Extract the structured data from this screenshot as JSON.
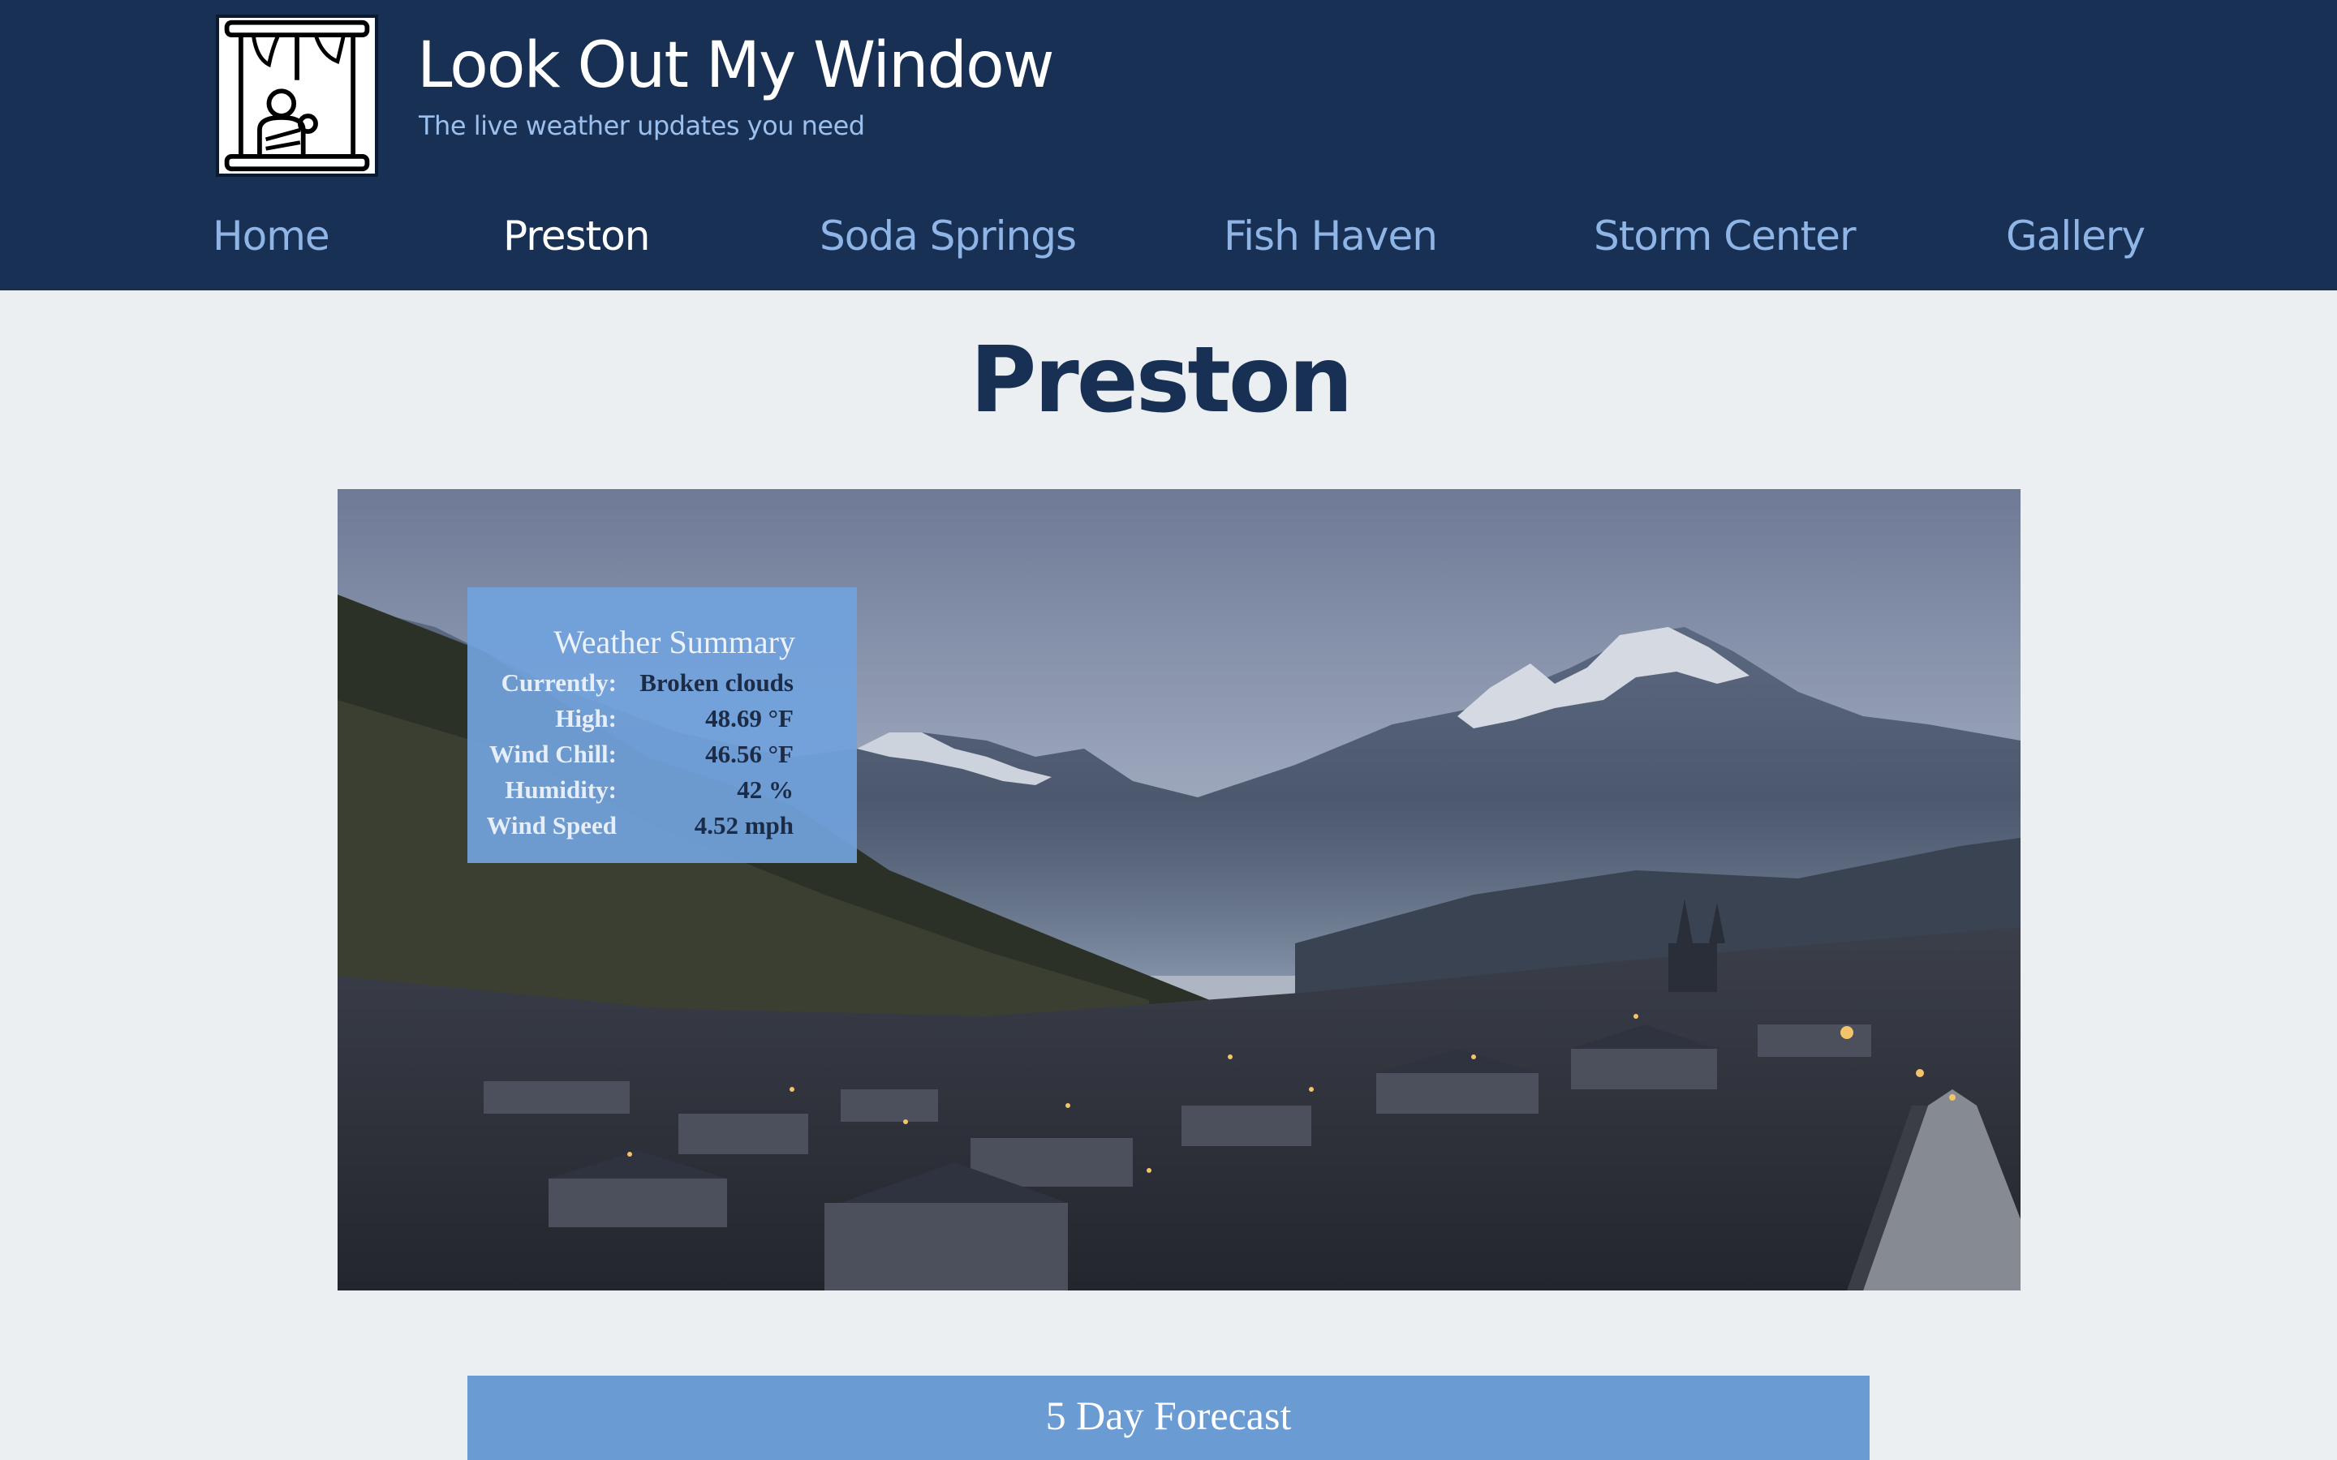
{
  "header": {
    "logo_icon": "window-person-icon",
    "title": "Look Out My Window",
    "tagline": "The live weather updates you need"
  },
  "nav": {
    "items": [
      {
        "label": "Home"
      },
      {
        "label": "Preston"
      },
      {
        "label": "Soda Springs"
      },
      {
        "label": "Fish Haven"
      },
      {
        "label": "Storm Center"
      },
      {
        "label": "Gallery"
      }
    ],
    "active": "Preston"
  },
  "page": {
    "title": "Preston"
  },
  "summary": {
    "title": "Weather Summary",
    "rows": [
      {
        "label": "Currently:",
        "value": "Broken clouds"
      },
      {
        "label": "High:",
        "value": "48.69 °F"
      },
      {
        "label": "Wind Chill:",
        "value": "46.56 °F"
      },
      {
        "label": "Humidity:",
        "value": "42 %"
      },
      {
        "label": "Wind Speed",
        "value": "4.52 mph"
      }
    ]
  },
  "forecast": {
    "title": "5 Day Forecast"
  },
  "colors": {
    "header_bg": "#183054",
    "nav_link": "#8fb4e6",
    "nav_active": "#ffffff",
    "page_bg": "#ebeff2",
    "summary_bg": "#71a1db",
    "forecast_bg": "#6a9bd3"
  }
}
